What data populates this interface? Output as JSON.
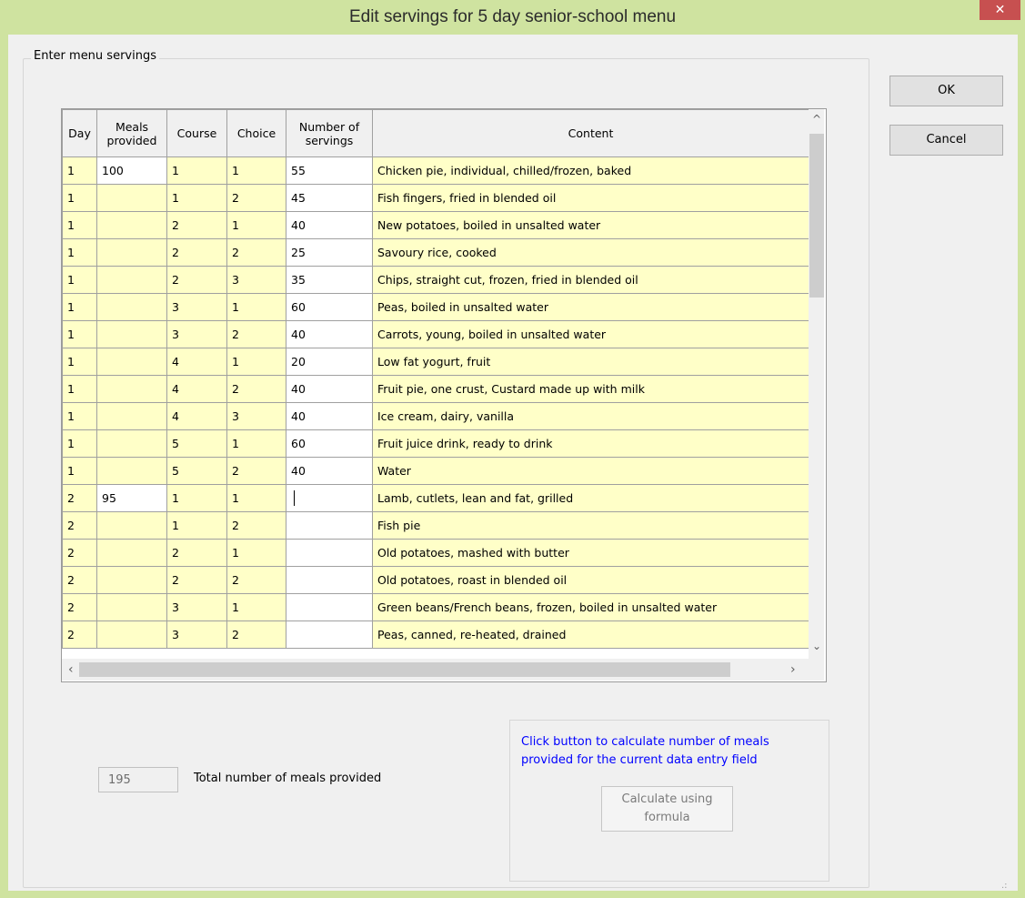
{
  "window": {
    "title": "Edit servings for 5 day senior-school menu",
    "close_glyph": "✕"
  },
  "group": {
    "legend": "Enter menu servings"
  },
  "buttons": {
    "ok": "OK",
    "cancel": "Cancel"
  },
  "grid": {
    "columns": [
      "Day",
      "Meals provided",
      "Course",
      "Choice",
      "Number of servings",
      "Content"
    ],
    "rows": [
      {
        "day": "1",
        "meals": "100",
        "course": "1",
        "choice": "1",
        "servings": "55",
        "content": "Chicken pie, individual, chilled/frozen, baked"
      },
      {
        "day": "1",
        "meals": "",
        "course": "1",
        "choice": "2",
        "servings": "45",
        "content": "Fish fingers, fried in blended oil"
      },
      {
        "day": "1",
        "meals": "",
        "course": "2",
        "choice": "1",
        "servings": "40",
        "content": "New potatoes, boiled in unsalted water"
      },
      {
        "day": "1",
        "meals": "",
        "course": "2",
        "choice": "2",
        "servings": "25",
        "content": "Savoury rice, cooked"
      },
      {
        "day": "1",
        "meals": "",
        "course": "2",
        "choice": "3",
        "servings": "35",
        "content": "Chips, straight cut, frozen, fried in blended oil"
      },
      {
        "day": "1",
        "meals": "",
        "course": "3",
        "choice": "1",
        "servings": "60",
        "content": "Peas, boiled in unsalted water"
      },
      {
        "day": "1",
        "meals": "",
        "course": "3",
        "choice": "2",
        "servings": "40",
        "content": "Carrots, young, boiled in unsalted water"
      },
      {
        "day": "1",
        "meals": "",
        "course": "4",
        "choice": "1",
        "servings": "20",
        "content": "Low fat yogurt, fruit"
      },
      {
        "day": "1",
        "meals": "",
        "course": "4",
        "choice": "2",
        "servings": "40",
        "content": "Fruit pie, one crust, Custard made up with milk"
      },
      {
        "day": "1",
        "meals": "",
        "course": "4",
        "choice": "3",
        "servings": "40",
        "content": "Ice cream, dairy, vanilla"
      },
      {
        "day": "1",
        "meals": "",
        "course": "5",
        "choice": "1",
        "servings": "60",
        "content": "Fruit juice drink, ready to drink"
      },
      {
        "day": "1",
        "meals": "",
        "course": "5",
        "choice": "2",
        "servings": "40",
        "content": "Water"
      },
      {
        "day": "2",
        "meals": "95",
        "course": "1",
        "choice": "1",
        "servings": "",
        "content": "Lamb, cutlets, lean and fat, grilled"
      },
      {
        "day": "2",
        "meals": "",
        "course": "1",
        "choice": "2",
        "servings": "",
        "content": "Fish pie"
      },
      {
        "day": "2",
        "meals": "",
        "course": "2",
        "choice": "1",
        "servings": "",
        "content": "Old potatoes, mashed with butter"
      },
      {
        "day": "2",
        "meals": "",
        "course": "2",
        "choice": "2",
        "servings": "",
        "content": "Old potatoes, roast in blended oil"
      },
      {
        "day": "2",
        "meals": "",
        "course": "3",
        "choice": "1",
        "servings": "",
        "content": "Green beans/French beans, frozen, boiled in unsalted water"
      },
      {
        "day": "2",
        "meals": "",
        "course": "3",
        "choice": "2",
        "servings": "",
        "content": "Peas, canned, re-heated, drained"
      }
    ]
  },
  "total": {
    "value": "195",
    "label": "Total number of meals provided"
  },
  "calc": {
    "note": "Click button to calculate number of meals provided for the current data entry field",
    "button": "Calculate using formula"
  },
  "icons": {
    "scroll_up": "^",
    "scroll_down": "⌄",
    "scroll_left": "‹",
    "scroll_right": "›",
    "grip": ".:"
  }
}
